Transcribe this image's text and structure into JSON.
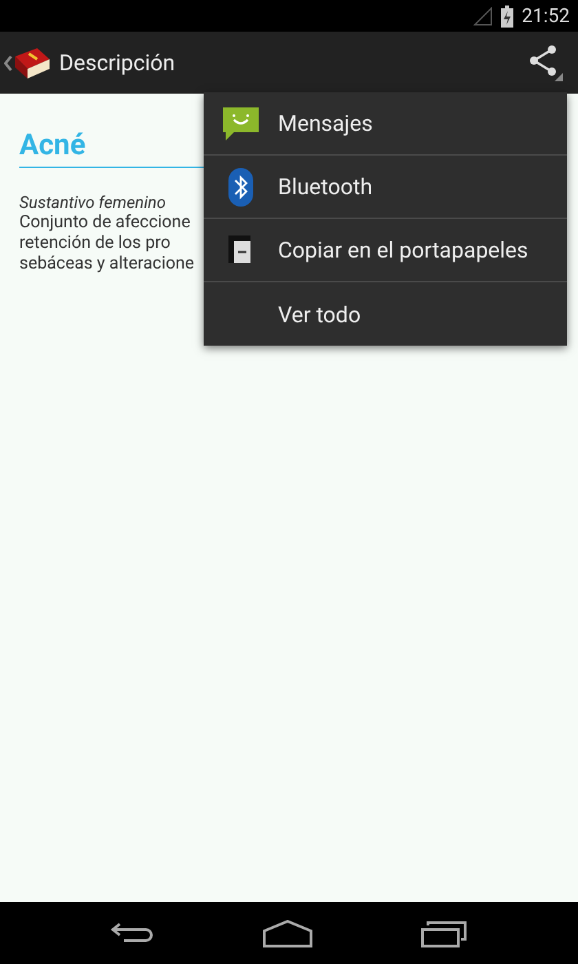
{
  "status_bar": {
    "time": "21:52"
  },
  "action_bar": {
    "title": "Descripción"
  },
  "entry": {
    "word": "Acné",
    "category": "Sustantivo femenino",
    "lines": [
      "Conjunto de afeccione",
      "retención de los pro",
      "sebáceas y alteracione"
    ]
  },
  "share_menu": [
    {
      "kind": "messages",
      "label": "Mensajes"
    },
    {
      "kind": "bluetooth",
      "label": "Bluetooth"
    },
    {
      "kind": "clipboard",
      "label": "Copiar en el portapapeles"
    },
    {
      "kind": "none",
      "label": "Ver todo"
    }
  ]
}
